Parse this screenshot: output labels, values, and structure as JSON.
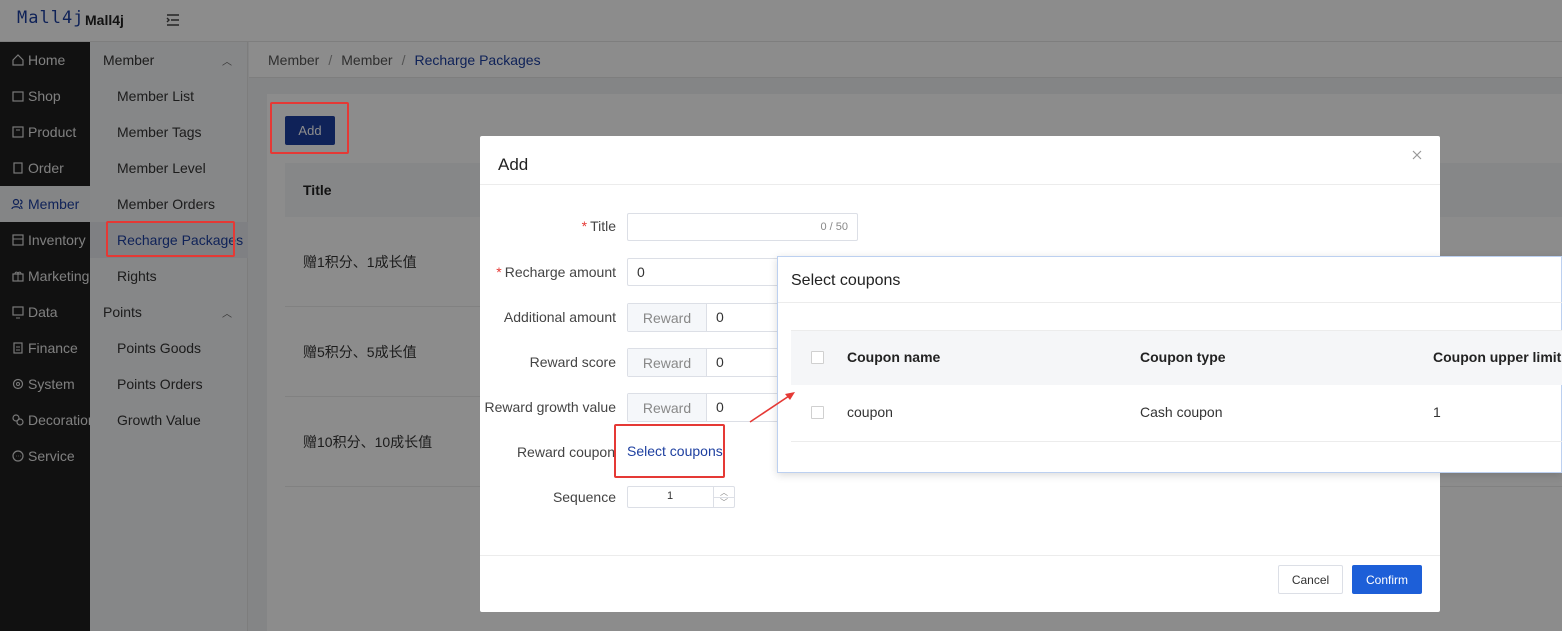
{
  "header": {
    "logo": "Mall4j",
    "brand": "Mall4j"
  },
  "nav": [
    {
      "label": "Home",
      "icon": "home-icon"
    },
    {
      "label": "Shop",
      "icon": "shop-icon"
    },
    {
      "label": "Product",
      "icon": "product-icon"
    },
    {
      "label": "Order",
      "icon": "order-icon"
    },
    {
      "label": "Member",
      "icon": "member-icon",
      "active": true
    },
    {
      "label": "Inventory",
      "icon": "inventory-icon"
    },
    {
      "label": "Marketing",
      "icon": "marketing-icon"
    },
    {
      "label": "Data",
      "icon": "data-icon"
    },
    {
      "label": "Finance",
      "icon": "finance-icon"
    },
    {
      "label": "System",
      "icon": "system-icon"
    },
    {
      "label": "Decoration",
      "icon": "decoration-icon"
    },
    {
      "label": "Service",
      "icon": "service-icon"
    }
  ],
  "submenu": {
    "group1": "Member",
    "group1_items": [
      "Member List",
      "Member Tags",
      "Member Level",
      "Member Orders",
      "Recharge Packages",
      "Rights"
    ],
    "group2": "Points",
    "group2_items": [
      "Points Goods",
      "Points Orders",
      "Growth Value"
    ]
  },
  "breadcrumb": [
    "Member",
    "Member",
    "Recharge Packages"
  ],
  "page": {
    "add_label": "Add",
    "table_header": "Title",
    "rows": [
      "赠1积分、1成长值",
      "赠5积分、5成长值",
      "赠10积分、10成长值"
    ]
  },
  "dialog": {
    "title": "Add",
    "title_label": "Title",
    "title_counter": "0 / 50",
    "recharge_label": "Recharge amount",
    "recharge_value": "0",
    "additional_label": "Additional amount",
    "reward_score_label": "Reward score",
    "reward_growth_label": "Reward growth value",
    "reward_prefix": "Reward",
    "additional_value": "0",
    "score_value": "0",
    "growth_value": "0",
    "reward_coupon_label": "Reward coupon",
    "select_coupons": "Select coupons",
    "sequence_label": "Sequence",
    "sequence_value": "1",
    "cancel": "Cancel",
    "confirm": "Confirm"
  },
  "coupon_popup": {
    "title": "Select coupons",
    "columns": [
      "Coupon name",
      "Coupon type",
      "Coupon upper limit"
    ],
    "row": {
      "name": "coupon",
      "type": "Cash coupon",
      "limit": "1"
    }
  },
  "colors": {
    "accent": "#1d3fa0",
    "primary_button": "#1d5fd8",
    "annotation": "#e53935",
    "nav_bg": "#1f1f1f"
  }
}
